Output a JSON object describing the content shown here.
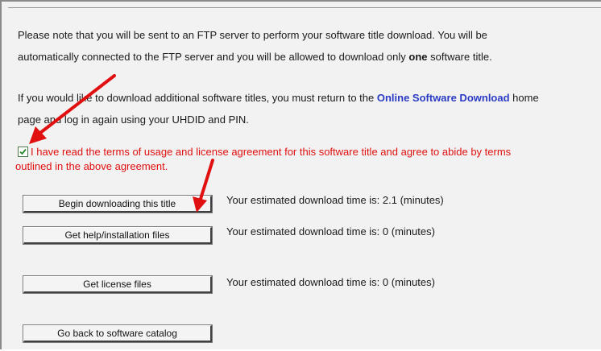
{
  "notice": {
    "line1": "Please note that you will be sent to an FTP server to perform your software title download. You will be",
    "line2_a": "automatically connected to the FTP server and you will be allowed to download only ",
    "line2_bold": "one",
    "line2_b": " software title.",
    "line3_a": "If you would like to download additional software titles, you must return to the ",
    "line3_link": "Online Software Download",
    "line3_b": " home",
    "line4": "page and log in again using your UHDID and PIN."
  },
  "agreement": {
    "checked": true,
    "line1": "I have read the terms of usage and license agreement for this software title and agree to abide by terms",
    "line2": "outlined in the above agreement."
  },
  "buttons": [
    {
      "label": "Begin downloading this title",
      "estimate": "Your estimated download time is: 2.1 (minutes)"
    },
    {
      "label": "Get help/installation files",
      "estimate": "Your estimated download time is: 0 (minutes)"
    },
    {
      "label": "Get license files",
      "estimate": "Your estimated download time is: 0 (minutes)"
    },
    {
      "label": "Go back to software catalog"
    }
  ],
  "colors": {
    "background": "#f2f2f2",
    "link": "#2b3cc4",
    "agreement_text": "#e01010",
    "annotation_arrow": "#e01010",
    "checkmark": "#2a8a2a"
  }
}
